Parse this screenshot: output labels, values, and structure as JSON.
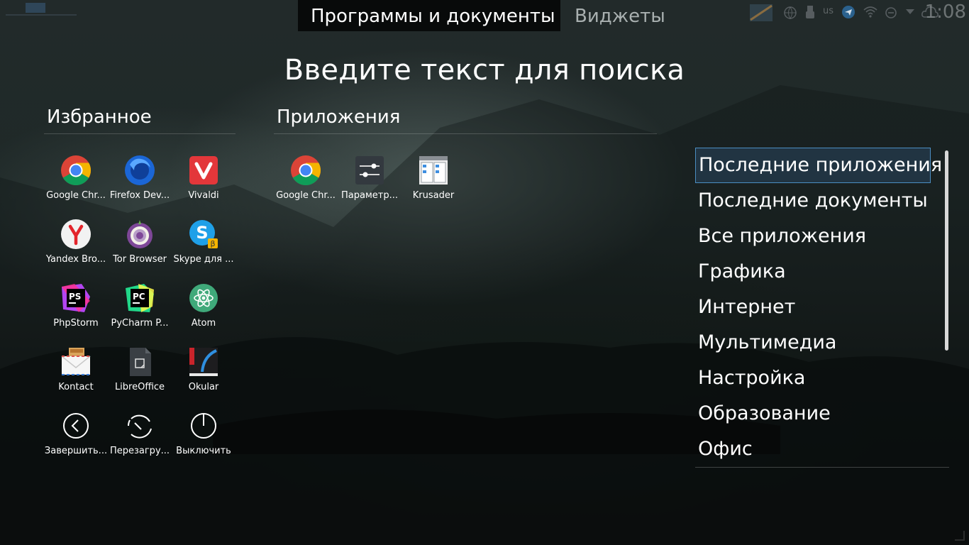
{
  "tabs": {
    "active_label": "Программы и документы",
    "inactive_label": "Виджеты"
  },
  "systray": {
    "keyboard_layout": "us",
    "clock": "1:08"
  },
  "search": {
    "prompt": "Введите текст для поиска"
  },
  "favorites": {
    "title": "Избранное",
    "items": [
      {
        "label": "Google Chr...",
        "icon": "chrome-icon"
      },
      {
        "label": "Firefox Dev...",
        "icon": "firefox-icon"
      },
      {
        "label": "Vivaldi",
        "icon": "vivaldi-icon"
      },
      {
        "label": "Yandex Bro...",
        "icon": "yandex-icon"
      },
      {
        "label": "Tor Browser",
        "icon": "tor-icon"
      },
      {
        "label": "Skype для ...",
        "icon": "skype-icon"
      },
      {
        "label": "PhpStorm",
        "icon": "phpstorm-icon"
      },
      {
        "label": "PyCharm P...",
        "icon": "pycharm-icon"
      },
      {
        "label": "Atom",
        "icon": "atom-icon"
      },
      {
        "label": "Kontact",
        "icon": "kontact-icon"
      },
      {
        "label": "LibreOffice",
        "icon": "libreoffice-icon"
      },
      {
        "label": "Okular",
        "icon": "okular-icon"
      },
      {
        "label": "Завершить...",
        "icon": "logout-icon"
      },
      {
        "label": "Перезагру...",
        "icon": "restart-icon"
      },
      {
        "label": "Выключить",
        "icon": "power-icon"
      }
    ]
  },
  "apps": {
    "title": "Приложения",
    "items": [
      {
        "label": "Google Chr...",
        "icon": "chrome-icon"
      },
      {
        "label": "Параметр...",
        "icon": "settings-icon"
      },
      {
        "label": "Krusader",
        "icon": "krusader-icon"
      }
    ]
  },
  "categories": {
    "selected_index": 0,
    "items": [
      "Последние приложения",
      "Последние документы",
      "Все приложения",
      "Графика",
      "Интернет",
      "Мультимедиа",
      "Настройка",
      "Образование",
      "Офис"
    ]
  },
  "colors": {
    "selection_border": "#4b8ec2",
    "text": "#ffffff",
    "inactive_tab": "#a9b0b0"
  }
}
